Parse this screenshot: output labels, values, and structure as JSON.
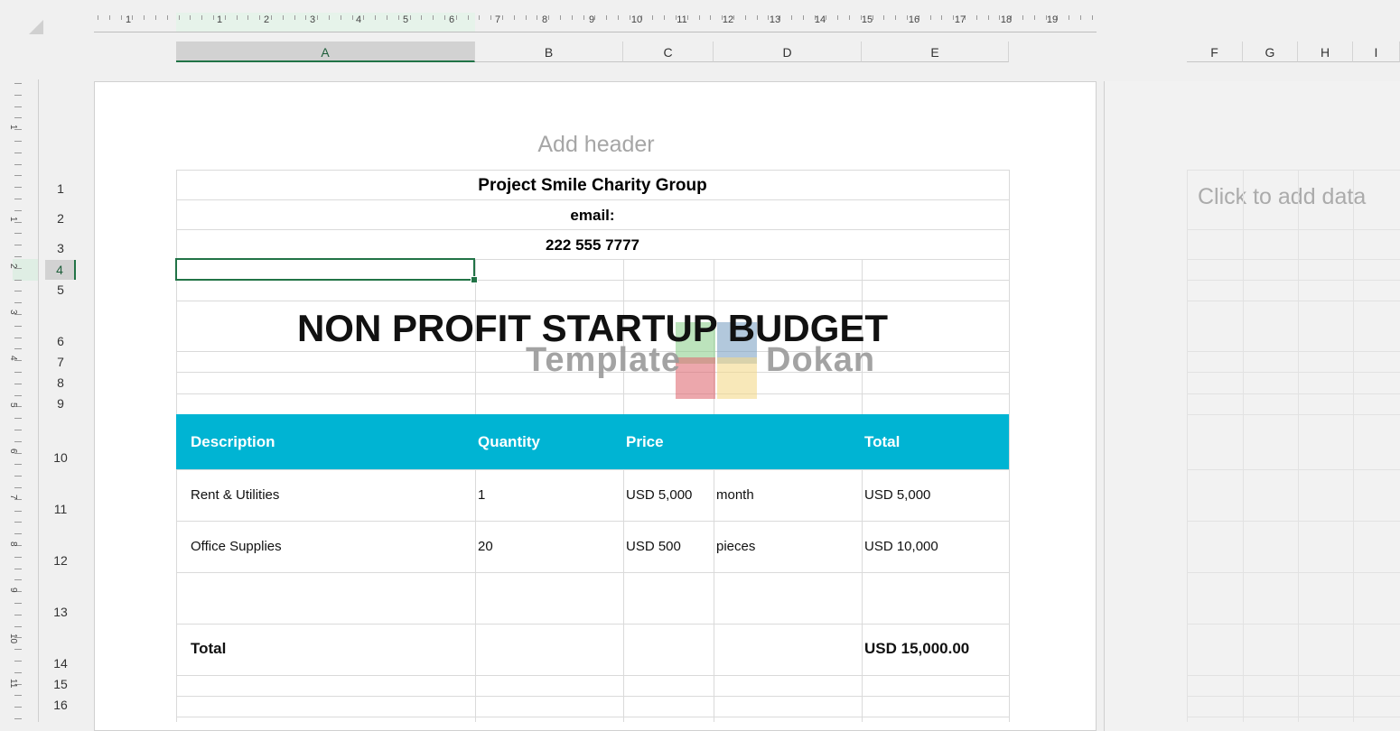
{
  "ruler": {
    "numbers": [
      "1",
      "1",
      "2",
      "3",
      "4",
      "5",
      "6",
      "7",
      "8",
      "9",
      "10",
      "11",
      "12",
      "13",
      "14",
      "15",
      "16",
      "17",
      "18",
      "19"
    ]
  },
  "vruler": {
    "numbers": [
      "1",
      "1",
      "2",
      "3",
      "4",
      "5",
      "6",
      "7",
      "8",
      "9",
      "10",
      "11"
    ]
  },
  "columns": [
    "A",
    "B",
    "C",
    "D",
    "E",
    "F",
    "G",
    "H",
    "I"
  ],
  "selected_column": "A",
  "rows": [
    "1",
    "2",
    "3",
    "4",
    "5",
    "6",
    "7",
    "8",
    "9",
    "10",
    "11",
    "12",
    "13",
    "14",
    "15",
    "16"
  ],
  "selected_row": "4",
  "page": {
    "add_header": "Add header",
    "click_to_add_data": "Click to add data"
  },
  "sheet": {
    "org_name": "Project Smile Charity Group",
    "email_label": "email:",
    "phone": "222 555 7777",
    "title": "NON PROFIT STARTUP BUDGET",
    "table_header": {
      "description": "Description",
      "quantity": "Quantity",
      "price": "Price",
      "total": "Total",
      "color": "#00b4d3"
    },
    "items": [
      {
        "description": "Rent & Utilities",
        "quantity": "1",
        "price": "USD 5,000",
        "unit": "month",
        "total": "USD 5,000"
      },
      {
        "description": "Office Supplies",
        "quantity": "20",
        "price": "USD 500",
        "unit": "pieces",
        "total": "USD 10,000"
      }
    ],
    "total_label": "Total",
    "total_value": "USD 15,000.00"
  },
  "watermark": {
    "left_text": "Template",
    "right_text": "Dokan",
    "colors": [
      "#8fd18f",
      "#7fa3c4",
      "#e06c74",
      "#f3d98a"
    ]
  },
  "accent_selection": "#217346"
}
